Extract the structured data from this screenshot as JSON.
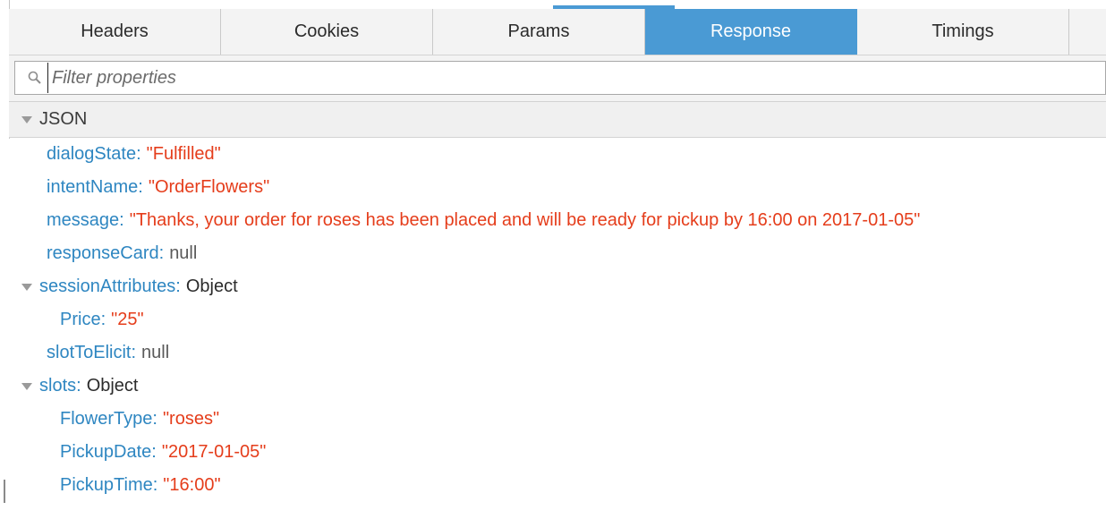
{
  "tabs": [
    {
      "label": "Headers",
      "active": false
    },
    {
      "label": "Cookies",
      "active": false
    },
    {
      "label": "Params",
      "active": false
    },
    {
      "label": "Response",
      "active": true
    },
    {
      "label": "Timings",
      "active": false
    }
  ],
  "filter": {
    "placeholder": "Filter properties",
    "value": ""
  },
  "section": {
    "label": "JSON"
  },
  "json": {
    "dialogState": {
      "key": "dialogState",
      "value": "\"Fulfilled\""
    },
    "intentName": {
      "key": "intentName",
      "value": "\"OrderFlowers\""
    },
    "message": {
      "key": "message",
      "value": "\"Thanks, your order for roses has been placed and will be ready for pickup by 16:00 on 2017-01-05\""
    },
    "responseCard": {
      "key": "responseCard",
      "value": "null"
    },
    "sessionAttributes": {
      "key": "sessionAttributes",
      "value": "Object"
    },
    "price": {
      "key": "Price",
      "value": "\"25\""
    },
    "slotToElicit": {
      "key": "slotToElicit",
      "value": "null"
    },
    "slots": {
      "key": "slots",
      "value": "Object"
    },
    "flowerType": {
      "key": "FlowerType",
      "value": "\"roses\""
    },
    "pickupDate": {
      "key": "PickupDate",
      "value": "\"2017-01-05\""
    },
    "pickupTime": {
      "key": "PickupTime",
      "value": "\"16:00\""
    }
  },
  "colors": {
    "accent": "#4a9ad4",
    "key": "#2e86c1",
    "string": "#e53d1b",
    "null": "#5a5a5a"
  },
  "icons": {
    "search": "search-icon",
    "expand": "triangle-down-icon"
  }
}
